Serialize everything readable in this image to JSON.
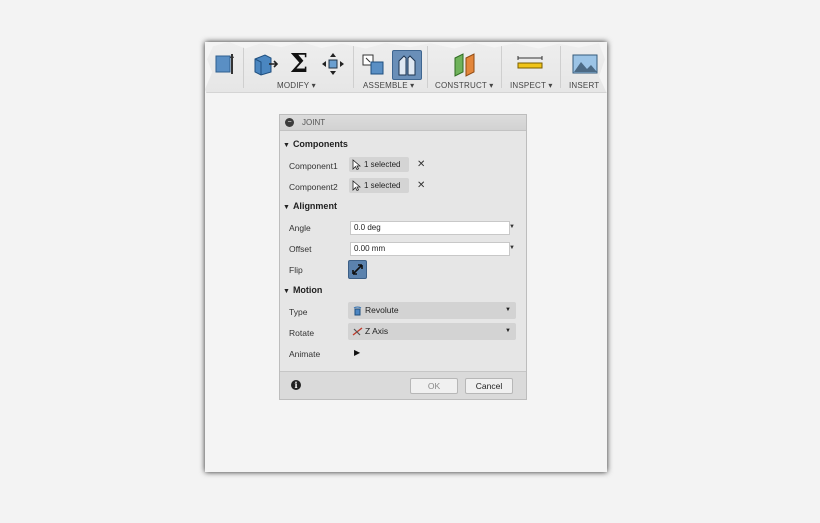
{
  "toolbar": {
    "groups": [
      {
        "label": "MODIFY ▾"
      },
      {
        "label": "ASSEMBLE ▾"
      },
      {
        "label": "CONSTRUCT ▾"
      },
      {
        "label": "INSPECT ▾"
      },
      {
        "label": "INSERT"
      }
    ],
    "sigma": "Σ"
  },
  "dialog": {
    "title": "JOINT",
    "sections": {
      "components": "Components",
      "alignment": "Alignment",
      "motion": "Motion"
    },
    "component1": {
      "label": "Component1",
      "value": "1 selected"
    },
    "component2": {
      "label": "Component2",
      "value": "1 selected"
    },
    "angle": {
      "label": "Angle",
      "value": "0.0 deg"
    },
    "offset": {
      "label": "Offset",
      "value": "0.00 mm"
    },
    "flip": {
      "label": "Flip"
    },
    "type": {
      "label": "Type",
      "value": "Revolute"
    },
    "rotate": {
      "label": "Rotate",
      "value": "Z Axis"
    },
    "animate": {
      "label": "Animate"
    },
    "ok_label": "OK",
    "cancel_label": "Cancel",
    "clear_glyph": "✕",
    "caret_glyph": "▼",
    "play_glyph": "▶",
    "info_glyph": "i",
    "min_glyph": "−"
  },
  "colors": {
    "active_tool": "#6a8fb8",
    "flip_button": "#5b82ad"
  }
}
